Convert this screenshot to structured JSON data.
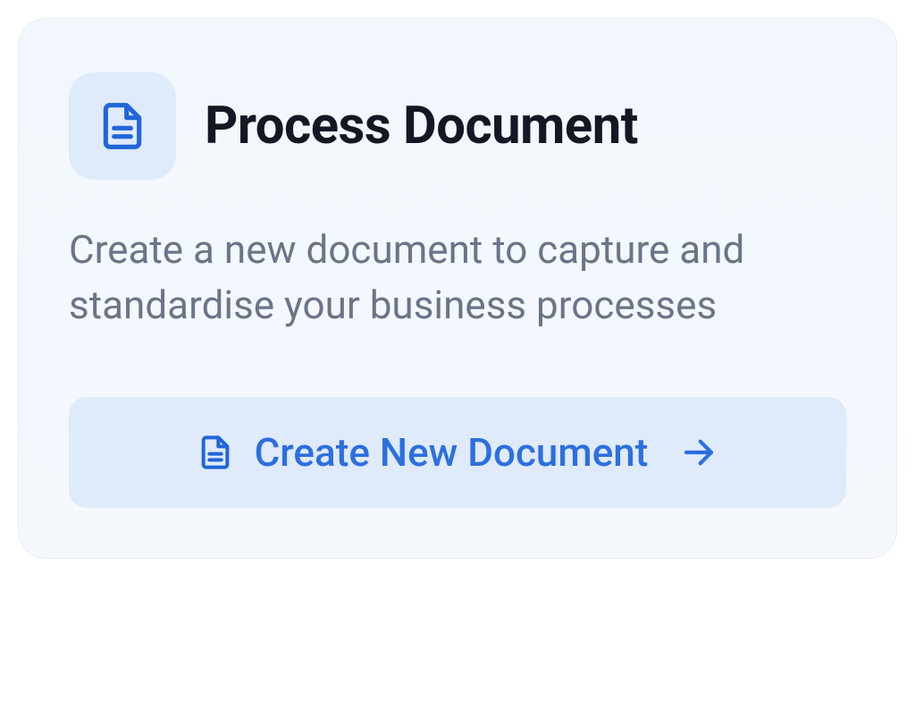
{
  "card": {
    "title": "Process Document",
    "description": "Create a new document to capture and standardise your business processes",
    "cta_label": "Create New Document"
  }
}
